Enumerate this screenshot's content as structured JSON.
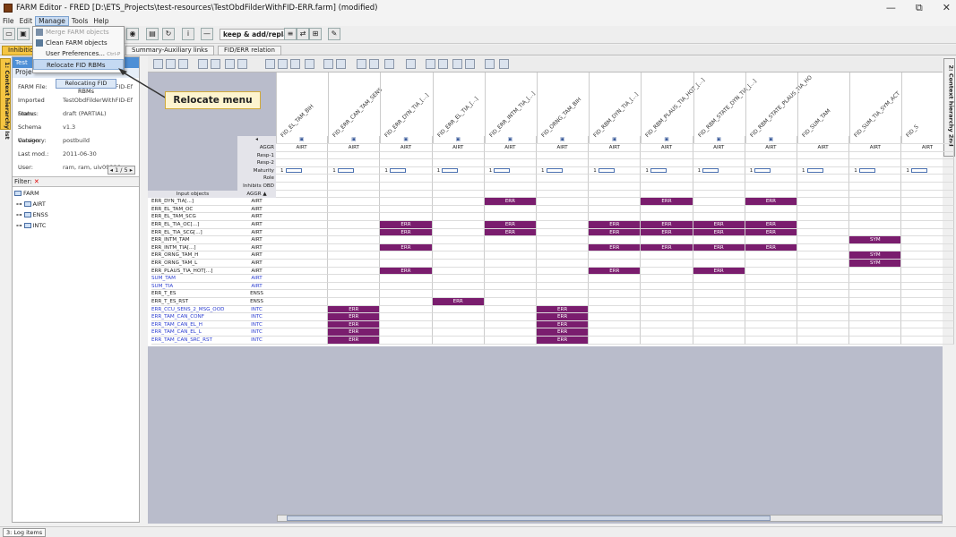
{
  "window": {
    "title": "FARM Editor - FRED [D:\\ETS_Projects\\test-resources\\TestObdFilderWithFID-ERR.farm] (modified)",
    "controls": [
      "—",
      "⧉",
      "✕"
    ]
  },
  "menubar": [
    "File",
    "Edit",
    "Manage",
    "Tools",
    "Help"
  ],
  "toolbar": {
    "keep_and_addreplace": "keep & add/replace"
  },
  "manage_menu": {
    "items": [
      {
        "label": "Merge FARM objects",
        "disabled": true
      },
      {
        "label": "Clean FARM objects",
        "disabled": false
      },
      {
        "label": "User Preferences...",
        "shortcut": "Ctrl-P",
        "disabled": false
      },
      {
        "label": "Relocate FID RBMs",
        "disabled": false,
        "highlighted": true
      }
    ]
  },
  "tooltip": "Relocating FID RBMs",
  "callout": "Relocate menu",
  "tabs": [
    "Inhibitio",
    "Summary-Auxiliary links",
    "FID/ERR relation"
  ],
  "left_vertical_tab": "1: Context hierarchy Ist",
  "right_vertical_tab": "2: Context hierarchy 2nd",
  "left_panel": {
    "header": "Test",
    "project_label": "Proje",
    "properties": [
      {
        "key": "FARM File:",
        "value": "TestObdFilderWithFID-Ef"
      },
      {
        "key": "Imported From:",
        "value": "TestObdFilderWithFID-Ef"
      },
      {
        "key": "Status:",
        "value": "draft (PARTIAL)"
      },
      {
        "key": "Schema Version:",
        "value": "v1.3"
      },
      {
        "key": "Category:",
        "value": "postbuild"
      },
      {
        "key": "Last mod.:",
        "value": "2011-06-30"
      },
      {
        "key": "User:",
        "value": "ram, ram, uiv09886"
      }
    ],
    "pager": "1 / 5",
    "filter_label": "Filter:",
    "tree": [
      "FARM",
      "AIRT",
      "ENSS",
      "INTC"
    ]
  },
  "grid": {
    "columns": [
      "FID_EL_TAM_BIH",
      "FID_ERR_CAN_TAM_SENS",
      "FID_ERR_DYN_TIA_[...]",
      "FID_ERR_EL_TIA_[...]",
      "FID_ERR_INTM_TIA_[...]",
      "FID_ORNG_TAM_BIH",
      "FID_RBM_DYN_TIA_[...]",
      "FID_RBM_PLAUS_TIA_HOT_[...]",
      "FID_RBM_STATE_DYN_TIA_[...]",
      "FID_RBM_STATE_PLAUS_TIA_HO",
      "FID_SUM_TAM",
      "FID_SUM_TIA_SYM_ACT",
      "FID_S"
    ],
    "header_rows": [
      "AGGR",
      "Resp-1",
      "Resp-2",
      "Maturity",
      "Role",
      "Inhibits OBD"
    ],
    "header_first_cell": "◂",
    "aggr_value": "AIRT",
    "maturity_value": "1",
    "input_objects_label": "Input objects",
    "aggr_sort_label": "AGGR ▲",
    "rows": [
      {
        "name": "ERR_DYN_TIA[...]",
        "aggr": "AIRT",
        "cells": [
          "",
          "",
          "",
          "",
          "ERR",
          "",
          "",
          "ERR",
          "",
          "ERR",
          "",
          "",
          ""
        ]
      },
      {
        "name": "ERR_EL_TAM_OC",
        "aggr": "AIRT",
        "cells": [
          "",
          "",
          "",
          "",
          "",
          "",
          "",
          "",
          "",
          "",
          "",
          "",
          ""
        ]
      },
      {
        "name": "ERR_EL_TAM_SCG",
        "aggr": "AIRT",
        "cells": [
          "",
          "",
          "",
          "",
          "",
          "",
          "",
          "",
          "",
          "",
          "",
          "",
          ""
        ]
      },
      {
        "name": "ERR_EL_TIA_OC[...]",
        "aggr": "AIRT",
        "cells": [
          "",
          "",
          "ERR",
          "",
          "ERR",
          "",
          "ERR",
          "ERR",
          "ERR",
          "ERR",
          "",
          "",
          ""
        ]
      },
      {
        "name": "ERR_EL_TIA_SCG[...]",
        "aggr": "AIRT",
        "cells": [
          "",
          "",
          "ERR",
          "",
          "ERR",
          "",
          "ERR",
          "ERR",
          "ERR",
          "ERR",
          "",
          "",
          ""
        ]
      },
      {
        "name": "ERR_INTM_TAM",
        "aggr": "AIRT",
        "cells": [
          "",
          "",
          "",
          "",
          "",
          "",
          "",
          "",
          "",
          "",
          "",
          "SYM",
          ""
        ]
      },
      {
        "name": "ERR_INTM_TIA[...]",
        "aggr": "AIRT",
        "cells": [
          "",
          "",
          "ERR",
          "",
          "",
          "",
          "ERR",
          "ERR",
          "ERR",
          "ERR",
          "",
          "",
          ""
        ]
      },
      {
        "name": "ERR_ORNG_TAM_H",
        "aggr": "AIRT",
        "cells": [
          "",
          "",
          "",
          "",
          "",
          "",
          "",
          "",
          "",
          "",
          "",
          "SYM",
          ""
        ]
      },
      {
        "name": "ERR_ORNG_TAM_L",
        "aggr": "AIRT",
        "cells": [
          "",
          "",
          "",
          "",
          "",
          "",
          "",
          "",
          "",
          "",
          "",
          "SYM",
          ""
        ]
      },
      {
        "name": "ERR_PLAUS_TIA_HOT[...]",
        "aggr": "AIRT",
        "cells": [
          "",
          "",
          "ERR",
          "",
          "",
          "",
          "ERR",
          "",
          "ERR",
          "",
          "",
          "",
          ""
        ]
      },
      {
        "name": "SUM_TAM",
        "aggr": "AIRT",
        "cells": [
          "",
          "",
          "",
          "",
          "",
          "",
          "",
          "",
          "",
          "",
          "",
          "",
          ""
        ],
        "link": true
      },
      {
        "name": "SUM_TIA",
        "aggr": "AIRT",
        "cells": [
          "",
          "",
          "",
          "",
          "",
          "",
          "",
          "",
          "",
          "",
          "",
          "",
          ""
        ],
        "link": true
      },
      {
        "name": "ERR_T_ES",
        "aggr": "ENSS",
        "cells": [
          "",
          "",
          "",
          "",
          "",
          "",
          "",
          "",
          "",
          "",
          "",
          "",
          ""
        ]
      },
      {
        "name": "ERR_T_ES_RST",
        "aggr": "ENSS",
        "cells": [
          "",
          "",
          "",
          "ERR",
          "",
          "",
          "",
          "",
          "",
          "",
          "",
          "",
          ""
        ]
      },
      {
        "name": "ERR_CCU_SENS_2_MSG_OOD",
        "aggr": "INTC",
        "cells": [
          "",
          "ERR",
          "",
          "",
          "",
          "ERR",
          "",
          "",
          "",
          "",
          "",
          "",
          ""
        ],
        "link": true
      },
      {
        "name": "ERR_TAM_CAN_CONF",
        "aggr": "INTC",
        "cells": [
          "",
          "ERR",
          "",
          "",
          "",
          "ERR",
          "",
          "",
          "",
          "",
          "",
          "",
          ""
        ],
        "link": true
      },
      {
        "name": "ERR_TAM_CAN_EL_H",
        "aggr": "INTC",
        "cells": [
          "",
          "ERR",
          "",
          "",
          "",
          "ERR",
          "",
          "",
          "",
          "",
          "",
          "",
          ""
        ],
        "link": true
      },
      {
        "name": "ERR_TAM_CAN_EL_L",
        "aggr": "INTC",
        "cells": [
          "",
          "ERR",
          "",
          "",
          "",
          "ERR",
          "",
          "",
          "",
          "",
          "",
          "",
          ""
        ],
        "link": true
      },
      {
        "name": "ERR_TAM_CAN_SRC_RST",
        "aggr": "INTC",
        "cells": [
          "",
          "ERR",
          "",
          "",
          "",
          "ERR",
          "",
          "",
          "",
          "",
          "",
          "",
          ""
        ],
        "link": true
      }
    ]
  },
  "statusbar": {
    "log_tab": "3: Log items"
  },
  "colors": {
    "accent_tab": "#f5c542",
    "cell_fill": "#7a1d6e",
    "link_text": "#2d3fd1",
    "header_blue": "#4d8fd6"
  }
}
